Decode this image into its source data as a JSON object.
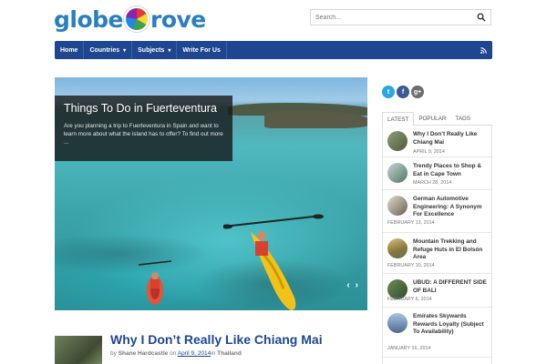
{
  "site": {
    "logo_part1": "globe",
    "logo_part2": "rove"
  },
  "search": {
    "placeholder": "Search..."
  },
  "nav": {
    "items": [
      {
        "label": "Home"
      },
      {
        "label": "Countries",
        "has_dropdown": true
      },
      {
        "label": "Subjects",
        "has_dropdown": true
      },
      {
        "label": "Write For Us"
      }
    ]
  },
  "hero": {
    "title": "Things To Do in Fuerteventura",
    "excerpt": "Are you planning a trip to Fuerteventura in Spain and want to learn more about what the island has to offer? To find out more ..."
  },
  "post": {
    "title": "Why I Don’t Really Like Chiang Mai",
    "by": "by",
    "author": "Shane Hardcastle",
    "on": "on",
    "date": "April 9, 2014",
    "in": "in",
    "category": "Thailand"
  },
  "social": [
    {
      "icon": "twitter-icon",
      "glyph": "t",
      "color": "#29a9e1"
    },
    {
      "icon": "facebook-icon",
      "glyph": "f",
      "color": "#3b5998"
    },
    {
      "icon": "google-plus-icon",
      "glyph": "g+",
      "color": "#6d6d6d"
    }
  ],
  "sidebar": {
    "tabs": [
      {
        "label": "LATEST",
        "active": true
      },
      {
        "label": "POPULAR",
        "active": false
      },
      {
        "label": "TAGS",
        "active": false
      }
    ],
    "entries": [
      {
        "title": "Why I Don’t Really Like Chiang Mai",
        "date": "APRIL 9, 2014"
      },
      {
        "title": "Trendy Places to Shop & Eat in Cape Town",
        "date": "MARCH 28, 2014"
      },
      {
        "title": "German Automotive Engineering: A Synonym For Excellence",
        "date": "FEBRUARY 13, 2014"
      },
      {
        "title": "Mountain Trekking and Refuge Huts in El Bolsón Area",
        "date": "FEBRUARY 10, 2014"
      },
      {
        "title": "UBUD: A DIFFERENT SIDE OF BALI",
        "date": "FEBRUARY 6, 2014"
      },
      {
        "title": "Emirates Skywards Rewards Loyalty (Subject To Availability)",
        "date": "JANUARY 16, 2014"
      }
    ]
  },
  "colors": {
    "brand": "#1f4690",
    "accent": "#2a7fbf"
  }
}
